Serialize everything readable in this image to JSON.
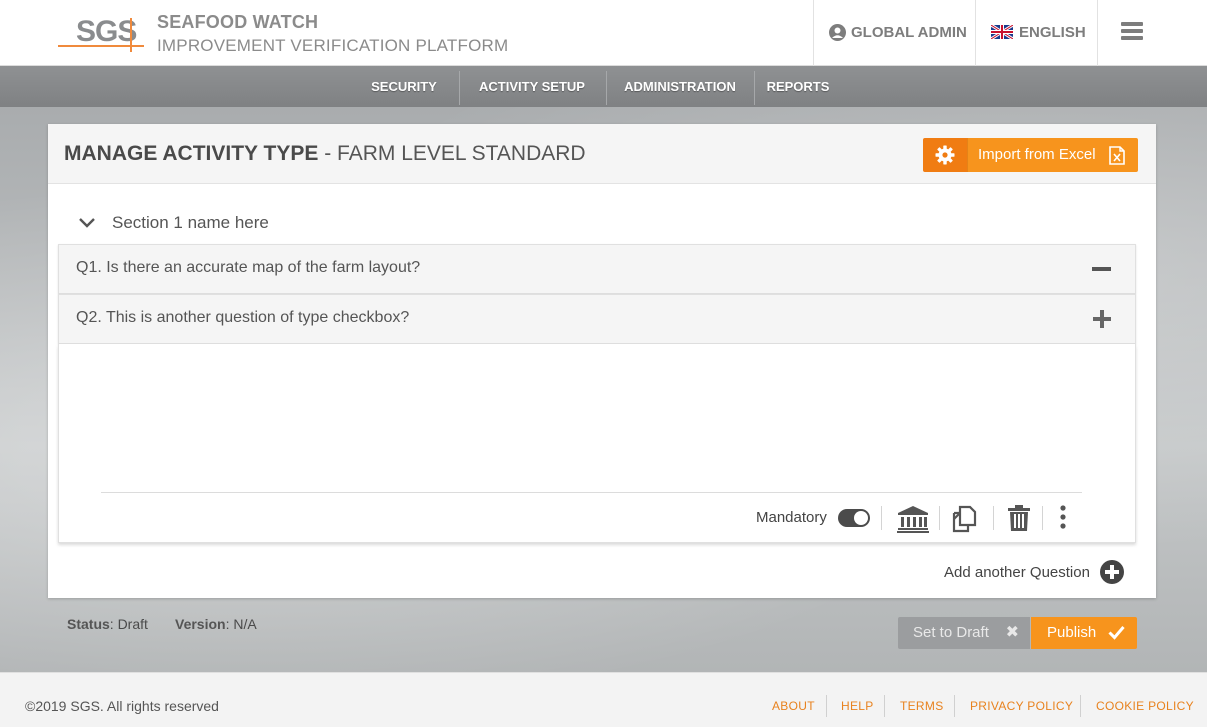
{
  "header": {
    "logo_text": "SGS",
    "brand_title": "SEAFOOD WATCH",
    "brand_subtitle": "IMPROVEMENT VERIFICATION PLATFORM",
    "user_label": "GLOBAL ADMIN",
    "user_icon": "user-circle-icon",
    "language_label": "ENGLISH",
    "language_icon": "uk-flag-icon",
    "menu_icon": "hamburger-icon"
  },
  "nav": {
    "items": [
      {
        "label": "SECURITY"
      },
      {
        "label": "ACTIVITY SETUP"
      },
      {
        "label": "ADMINISTRATION"
      },
      {
        "label": "REPORTS"
      }
    ]
  },
  "page": {
    "title_bold": "MANAGE ACTIVITY TYPE",
    "title_sep": " - ",
    "title_sub": "FARM LEVEL STANDARD",
    "import_label": "Import from Excel",
    "gear_icon": "gear-icon",
    "excel_icon": "excel-file-icon"
  },
  "section": {
    "chevron_icon": "chevron-down-icon",
    "name": "Section 1 name here"
  },
  "questions": [
    {
      "text": "Q1.  Is there an accurate map of the farm layout?",
      "state": "expanded",
      "icon": "minus-icon"
    },
    {
      "text": "Q2. This is another question of type checkbox?",
      "state": "collapsed",
      "icon": "plus-icon"
    }
  ],
  "question_tools": {
    "mandatory_label": "Mandatory",
    "mandatory_on": true,
    "icons": [
      "bank-icon",
      "copy-icon",
      "trash-icon",
      "more-vertical-icon"
    ]
  },
  "add_question_label": "Add another Question",
  "status": {
    "status_label": "Status",
    "status_value": ": Draft",
    "version_label": "Version",
    "version_value": ": N/A"
  },
  "actions": {
    "set_draft_label": "Set to Draft",
    "publish_label": "Publish"
  },
  "footer": {
    "copyright": "©2019 SGS. All rights reserved",
    "links": [
      "ABOUT",
      "HELP",
      "TERMS",
      "PRIVACY POLICY",
      "COOKIE POLICY"
    ]
  },
  "colors": {
    "accent": "#f7941d",
    "accent_dark": "#f07c12",
    "nav_bg": "#8a8c8e",
    "link": "#e8821e"
  }
}
